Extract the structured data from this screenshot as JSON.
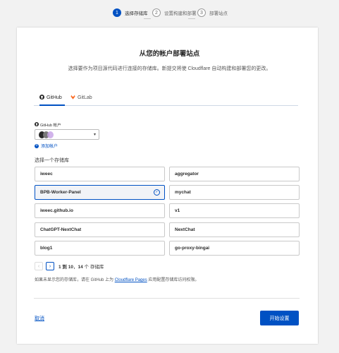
{
  "stepper": {
    "steps": [
      {
        "num": "1",
        "label": "选择存储库"
      },
      {
        "num": "2",
        "label": "设置构建和部署"
      },
      {
        "num": "3",
        "label": "部署站点"
      }
    ]
  },
  "header": {
    "title": "从您的帐户部署站点",
    "subtitle": "选择要作为项目源代码进行连接的存储库。新提交将使 Cloudflare 自动构建和部署您的更改。"
  },
  "tabs": [
    {
      "label": "GitHub",
      "icon": "github-icon"
    },
    {
      "label": "GitLab",
      "icon": "gitlab-icon"
    }
  ],
  "account": {
    "label": "GitHub 帐户",
    "add_label": "添加帐户"
  },
  "repos": {
    "title": "选择一个存储库",
    "items": [
      "iweec",
      "aggregator",
      "BPB-Worker-Panel",
      "mychat",
      "iweec.github.io",
      "v1",
      "ChatGPT-NextChat",
      "NextChat",
      "blog1",
      "go-proxy-bingai"
    ],
    "selected": "BPB-Worker-Panel"
  },
  "pagination": {
    "range": "1 到 10",
    "sep": "，",
    "total": "14",
    "suffix": "个 存储库"
  },
  "hint": {
    "prefix": "如果未显示您的存储库，请在 GitHub 上为 ",
    "link": "Cloudflare Pages",
    "suffix": " 应用配置存储库访问权限。"
  },
  "footer": {
    "cancel": "取消",
    "start": "开始设置"
  },
  "colors": {
    "accent": "#0051c3",
    "gitlab": "#fc6d26"
  }
}
